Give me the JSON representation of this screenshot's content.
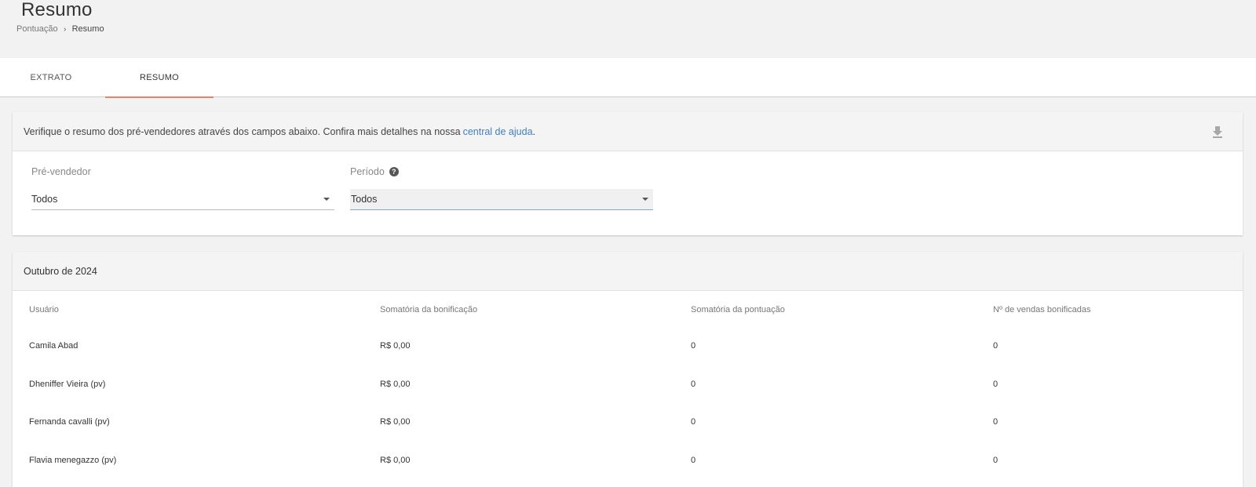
{
  "header": {
    "title": "Resumo",
    "breadcrumb": {
      "parent": "Pontuação",
      "separator": "›",
      "current": "Resumo"
    }
  },
  "tabs": [
    {
      "label": "EXTRATO",
      "active": false
    },
    {
      "label": "RESUMO",
      "active": true
    }
  ],
  "colors": {
    "active_tab_underline": "#e8846a",
    "link": "#3f7fc2"
  },
  "info": {
    "text": "Verifique o resumo dos pré-vendedores através dos campos abaixo. Confira mais detalhes na nossa",
    "link_text": "central de ajuda",
    "suffix": ".",
    "download_icon": "download-icon"
  },
  "filters": {
    "seller": {
      "label": "Pré-vendedor",
      "value": "Todos"
    },
    "period": {
      "label": "Período",
      "help": "?",
      "value": "Todos"
    }
  },
  "summary": {
    "title": "Outubro de 2024",
    "columns": [
      "Usuário",
      "Somatória da bonificação",
      "Somatória da pontuação",
      "Nº de vendas bonificadas"
    ],
    "rows": [
      [
        "Camila Abad",
        "R$ 0,00",
        "0",
        "0"
      ],
      [
        "Dheniffer Vieira (pv)",
        "R$ 0,00",
        "0",
        "0"
      ],
      [
        "Fernanda cavalli (pv)",
        "R$ 0,00",
        "0",
        "0"
      ],
      [
        "Flavia menegazzo (pv)",
        "R$ 0,00",
        "0",
        "0"
      ]
    ]
  }
}
